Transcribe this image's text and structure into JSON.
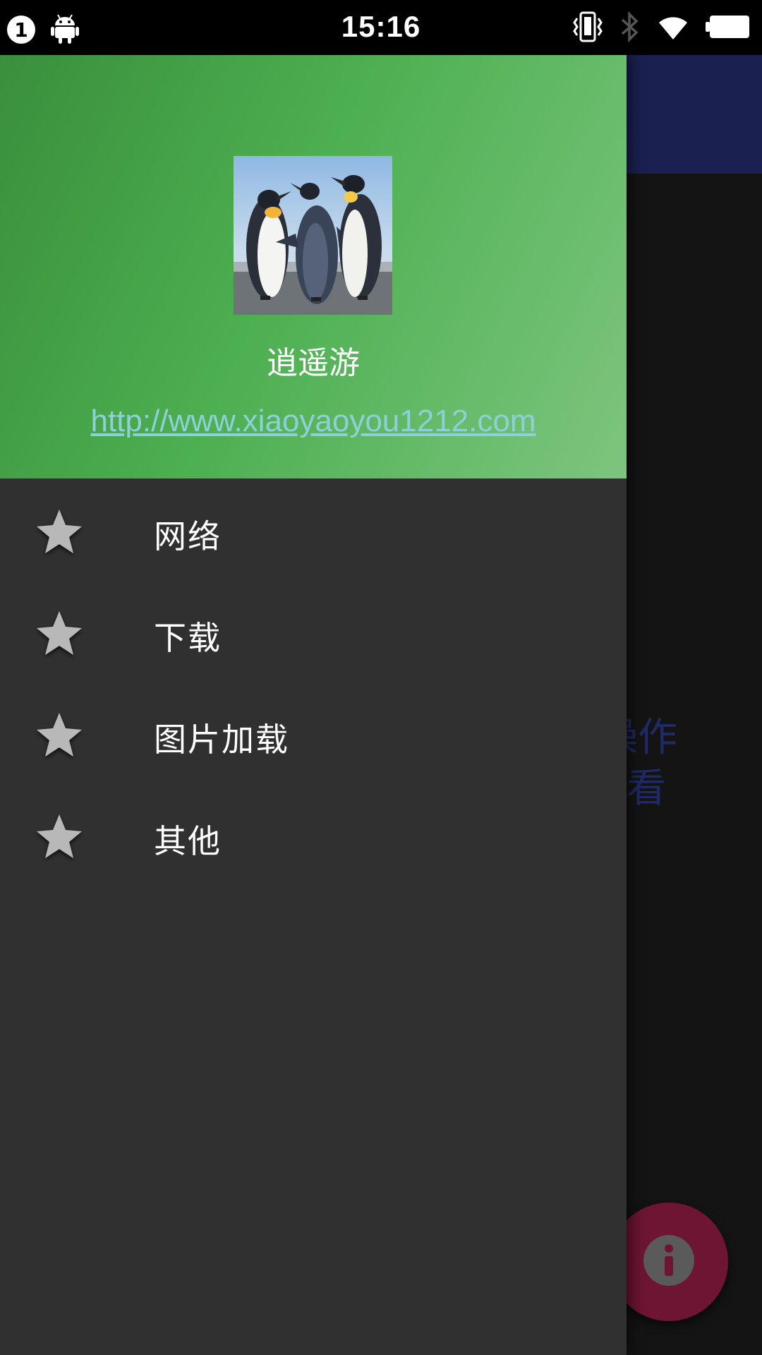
{
  "status_bar": {
    "notification_count": "1",
    "time": "15:16",
    "icons": [
      "android-icon",
      "vibrate-icon",
      "bluetooth-icon",
      "wifi-icon",
      "battery-icon"
    ]
  },
  "drawer": {
    "header": {
      "avatar_icon": "penguins-avatar",
      "username": "逍遥游",
      "link": "http://www.xiaoyaoyou1212.com",
      "gradient_colors": [
        "#3a8f3c",
        "#4caf50",
        "#7dc57f"
      ]
    },
    "menu_items": [
      {
        "label": "网络",
        "icon": "star-icon"
      },
      {
        "label": "下载",
        "icon": "star-icon"
      },
      {
        "label": "图片加载",
        "icon": "star-icon"
      },
      {
        "label": "其他",
        "icon": "star-icon"
      }
    ]
  },
  "background": {
    "toolbar_color": "#1a2150",
    "hint_lines": [
      "操作",
      "看"
    ],
    "fab_icon": "info-icon",
    "fab_color": "#6d1532"
  }
}
